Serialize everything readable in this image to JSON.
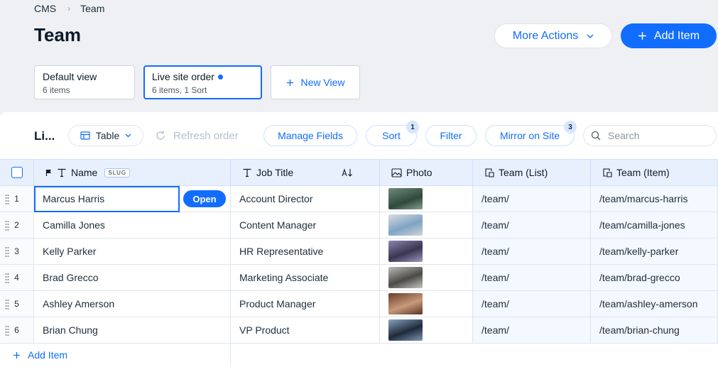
{
  "breadcrumb": {
    "root": "CMS",
    "current": "Team"
  },
  "page_title": "Team",
  "header_buttons": {
    "more_actions": "More Actions",
    "add_item": "Add Item"
  },
  "views": [
    {
      "title": "Default view",
      "subtitle": "6 items"
    },
    {
      "title": "Live site order",
      "subtitle": "6 items, 1 Sort"
    }
  ],
  "new_view": "New View",
  "toolbar": {
    "title": "Li...",
    "table": "Table",
    "refresh": "Refresh order",
    "manage_fields": "Manage Fields",
    "sort": "Sort",
    "sort_count": "1",
    "filter": "Filter",
    "mirror": "Mirror on Site",
    "mirror_count": "3",
    "search_placeholder": "Search"
  },
  "columns": {
    "name": "Name",
    "slug_badge": "SLUG",
    "job_title": "Job Title",
    "photo": "Photo",
    "team_list": "Team (List)",
    "team_item": "Team (Item)"
  },
  "open_label": "Open",
  "rows": [
    {
      "n": "1",
      "name": "Marcus Harris",
      "job": "Account Director",
      "list": "/team/",
      "item": "/team/marcus-harris"
    },
    {
      "n": "2",
      "name": "Camilla Jones",
      "job": "Content Manager",
      "list": "/team/",
      "item": "/team/camilla-jones"
    },
    {
      "n": "3",
      "name": "Kelly Parker",
      "job": "HR Representative",
      "list": "/team/",
      "item": "/team/kelly-parker"
    },
    {
      "n": "4",
      "name": "Brad Grecco",
      "job": "Marketing Associate",
      "list": "/team/",
      "item": "/team/brad-grecco"
    },
    {
      "n": "5",
      "name": "Ashley Amerson",
      "job": "Product Manager",
      "list": "/team/",
      "item": "/team/ashley-amerson"
    },
    {
      "n": "6",
      "name": "Brian Chung",
      "job": "VP Product",
      "list": "/team/",
      "item": "/team/brian-chung"
    }
  ],
  "add_item_row": "Add Item",
  "colors": {
    "accent": "#116dff",
    "header_bg": "#e8f0fe"
  }
}
